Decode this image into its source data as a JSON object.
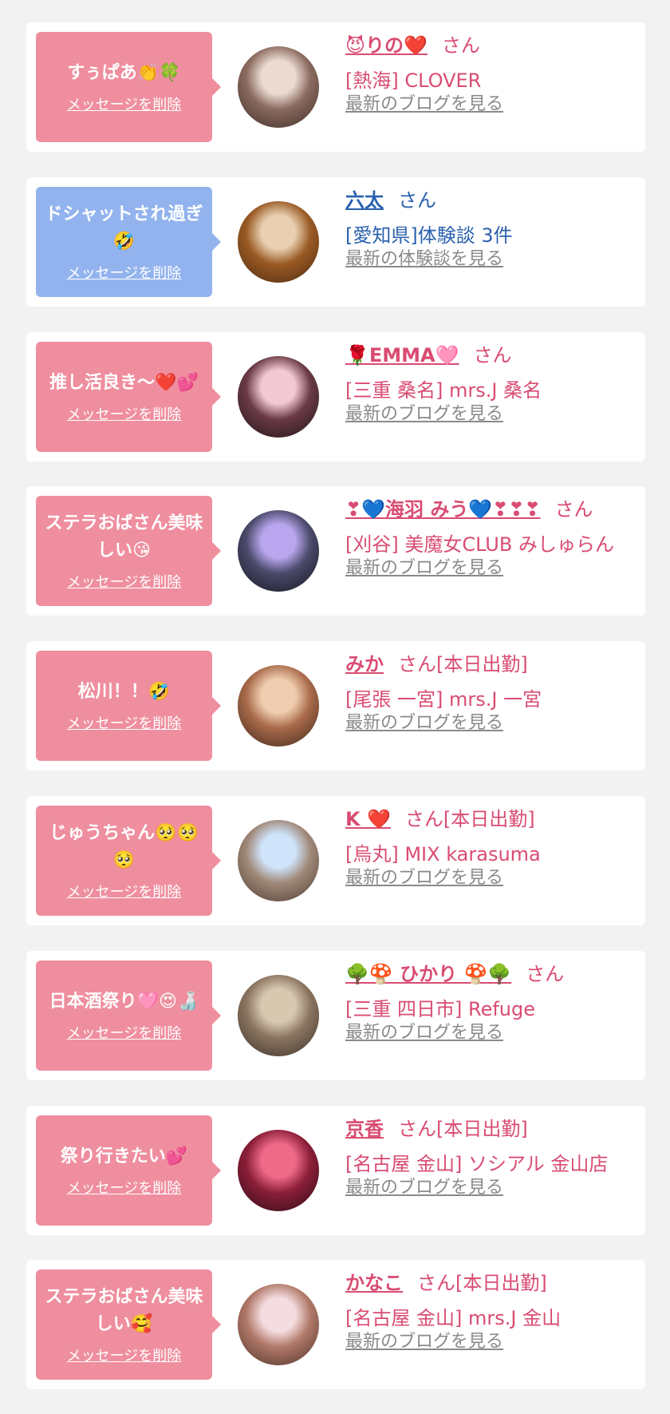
{
  "messages": [
    {
      "comment": "すぅぱあ👏🍀",
      "delete_label": "メッセージを削除",
      "name": "😈りの❤️",
      "san": "さん",
      "shop": "[熱海] CLOVER",
      "link": "最新のブログを見る",
      "theme": "pink",
      "avatar_colors": [
        "#eadad2",
        "#8a6a5e",
        "#3c2c28"
      ]
    },
    {
      "comment": "ドシャットされ過ぎ🤣",
      "delete_label": "メッセージを削除",
      "name": "六太",
      "san": "さん",
      "shop": "[愛知県]体験談 3件",
      "link": "最新の体験談を見る",
      "theme": "blue",
      "avatar_colors": [
        "#e8d0b0",
        "#9a5a24",
        "#4a2a10"
      ]
    },
    {
      "comment": "推し活良き〜❤️💕",
      "delete_label": "メッセージを削除",
      "name": "🌹EMMA🩷",
      "san": "さん",
      "shop": "[三重 桑名] mrs.J 桑名",
      "link": "最新のブログを見る",
      "theme": "pink",
      "avatar_colors": [
        "#f3c9d4",
        "#6a3a44",
        "#1c1416"
      ]
    },
    {
      "comment": "ステラおばさん美味しい😘",
      "delete_label": "メッセージを削除",
      "name": "❣💙海羽 みう💙❣❣❣",
      "san": "さん",
      "shop": "[刈谷] 美魔女CLUB みしゅらん",
      "link": "最新のブログを見る",
      "theme": "pink",
      "avatar_colors": [
        "#b9a6ee",
        "#4a4a6a",
        "#14141e"
      ]
    },
    {
      "comment": "松川！！🤣",
      "delete_label": "メッセージを削除",
      "name": "みか",
      "san": "さん[本日出勤]",
      "shop": "[尾張 一宮] mrs.J 一宮",
      "link": "最新のブログを見る",
      "theme": "pink",
      "avatar_colors": [
        "#f0cdb0",
        "#a86a4a",
        "#3a2418"
      ]
    },
    {
      "comment": "じゅうちゃん🥺🥺🥺",
      "delete_label": "メッセージを削除",
      "name": "K ❤️",
      "san": "さん[本日出勤]",
      "shop": "[烏丸] MIX karasuma",
      "link": "最新のブログを見る",
      "theme": "pink",
      "avatar_colors": [
        "#cfe4fb",
        "#a08878",
        "#4a3a30"
      ]
    },
    {
      "comment": "日本酒祭り🩷😍🍶",
      "delete_label": "メッセージを削除",
      "name": "🌳🍄 ひかり 🍄🌳",
      "san": "さん",
      "shop": "[三重 四日市] Refuge",
      "link": "最新のブログを見る",
      "theme": "pink",
      "avatar_colors": [
        "#d8c8b0",
        "#8a7460",
        "#3a3028"
      ]
    },
    {
      "comment": "祭り行きたい💕",
      "delete_label": "メッセージを削除",
      "name": "京香",
      "san": "さん[本日出勤]",
      "shop": "[名古屋 金山] ソシアル 金山店",
      "link": "最新のブログを見る",
      "theme": "pink",
      "avatar_colors": [
        "#ee6a88",
        "#8a1e38",
        "#2a0c16"
      ]
    },
    {
      "comment": "ステラおばさん美味しい🥰",
      "delete_label": "メッセージを削除",
      "name": "かなこ",
      "san": "さん[本日出勤]",
      "shop": "[名古屋 金山] mrs.J 金山",
      "link": "最新のブログを見る",
      "theme": "pink",
      "avatar_colors": [
        "#f4dde0",
        "#b07868",
        "#4a3028"
      ]
    }
  ]
}
